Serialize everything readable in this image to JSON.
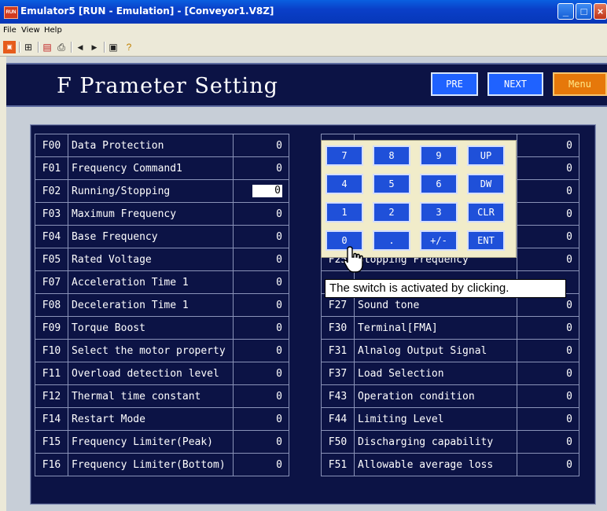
{
  "window": {
    "title": "Emulator5 [RUN - Emulation] - [Conveyor1.V8Z]",
    "app_icon_text": "RUN"
  },
  "menubar": [
    "File",
    "View",
    "Help"
  ],
  "toolbar": {
    "icons": [
      "run-icon",
      "grid-icon",
      "monitor-icon",
      "print-icon",
      "prev-icon",
      "next-icon",
      "window-icon",
      "help-icon"
    ]
  },
  "header": {
    "title": "F Prameter Setting",
    "pre": "PRE",
    "next": "NEXT",
    "menu": "Menu"
  },
  "left_table": [
    {
      "code": "F00",
      "name": "Data Protection",
      "value": "0"
    },
    {
      "code": "F01",
      "name": "Frequency Command1",
      "value": "0"
    },
    {
      "code": "F02",
      "name": "Running/Stopping",
      "value": "0"
    },
    {
      "code": "F03",
      "name": "Maximum Frequency",
      "value": "0"
    },
    {
      "code": "F04",
      "name": "Base Frequency",
      "value": "0"
    },
    {
      "code": "F05",
      "name": "Rated Voltage",
      "value": "0"
    },
    {
      "code": "F07",
      "name": "Acceleration Time 1",
      "value": "0"
    },
    {
      "code": "F08",
      "name": "Deceleration Time 1",
      "value": "0"
    },
    {
      "code": "F09",
      "name": "Torque Boost",
      "value": "0"
    },
    {
      "code": "F10",
      "name": "Select the motor property",
      "value": "0"
    },
    {
      "code": "F11",
      "name": "Overload detection level",
      "value": "0"
    },
    {
      "code": "F12",
      "name": "Thermal time constant",
      "value": "0"
    },
    {
      "code": "F14",
      "name": "Restart Mode",
      "value": "0"
    },
    {
      "code": "F15",
      "name": "Frequency Limiter(Peak)",
      "value": "0"
    },
    {
      "code": "F16",
      "name": "Frequency Limiter(Bottom)",
      "value": "0"
    }
  ],
  "right_table": [
    {
      "code": "",
      "name": "",
      "value": "0"
    },
    {
      "code": "",
      "name": "",
      "value": "0"
    },
    {
      "code": "",
      "name": "",
      "value": "0"
    },
    {
      "code": "",
      "name": "",
      "value": "0"
    },
    {
      "code": "",
      "name": "",
      "value": "0"
    },
    {
      "code": "F25",
      "name": "Stopping Frequency",
      "value": "0"
    },
    {
      "code": "",
      "name": "",
      "value": ""
    },
    {
      "code": "F27",
      "name": "Sound tone",
      "value": "0"
    },
    {
      "code": "F30",
      "name": "Terminal[FMA]",
      "value": "0"
    },
    {
      "code": "F31",
      "name": "Alnalog Output Signal",
      "value": "0"
    },
    {
      "code": "F37",
      "name": "Load Selection",
      "value": "0"
    },
    {
      "code": "F43",
      "name": "Operation condition",
      "value": "0"
    },
    {
      "code": "F44",
      "name": "Limiting Level",
      "value": "0"
    },
    {
      "code": "F50",
      "name": "Discharging capability",
      "value": "0"
    },
    {
      "code": "F51",
      "name": "Allowable average loss",
      "value": "0"
    }
  ],
  "keypad": {
    "keys": [
      "7",
      "8",
      "9",
      "UP",
      "4",
      "5",
      "6",
      "DW",
      "1",
      "2",
      "3",
      "CLR",
      "0",
      ".",
      "+/-",
      "ENT"
    ]
  },
  "tooltip": "The switch is activated by clicking."
}
